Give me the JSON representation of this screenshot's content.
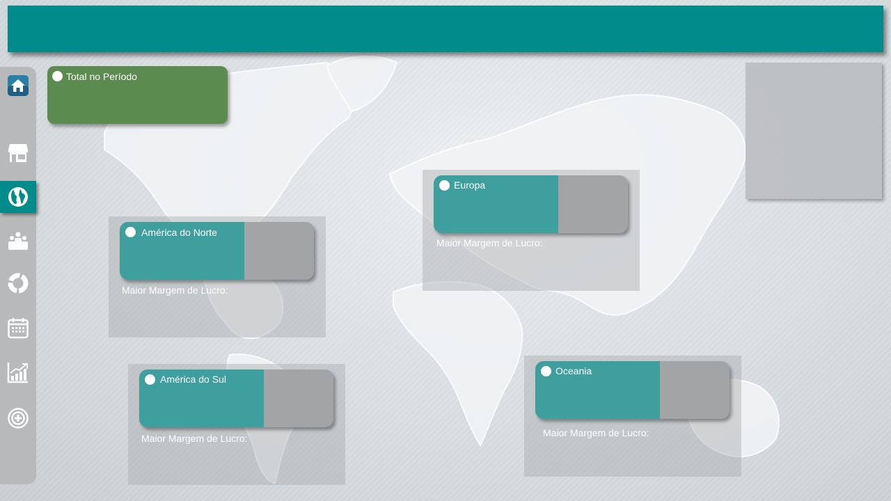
{
  "header": {
    "title": ""
  },
  "sidebar": {
    "items": [
      {
        "icon": "home-icon",
        "active": false
      },
      {
        "icon": "store-icon",
        "active": false
      },
      {
        "icon": "globe-icon",
        "active": true
      },
      {
        "icon": "people-icon",
        "active": false
      },
      {
        "icon": "donut-chart-icon",
        "active": false
      },
      {
        "icon": "calendar-icon",
        "active": false
      },
      {
        "icon": "growth-chart-icon",
        "active": false
      },
      {
        "icon": "add-circle-icon",
        "active": false
      }
    ]
  },
  "total_card": {
    "label": "Total no Período",
    "value": ""
  },
  "regions": [
    {
      "name": "América do Norte",
      "detail_label": "Maior Margem de Lucro:",
      "detail_value": "",
      "share": 0.64
    },
    {
      "name": "Europa",
      "detail_label": "Maior Margem de Lucro:",
      "detail_value": "",
      "share": 0.64
    },
    {
      "name": "América do Sul",
      "detail_label": "Maior Margem de Lucro:",
      "detail_value": "",
      "share": 0.64
    },
    {
      "name": "Oceania",
      "detail_label": "Maior Margem de Lucro:",
      "detail_value": "",
      "share": 0.64
    }
  ],
  "colors": {
    "header": "#028b8b",
    "active_nav": "#028b8b",
    "total_card": "#5b8b4f",
    "kpi_fill": "#3f9f9f",
    "kpi_rest": "#a3a4a5"
  }
}
